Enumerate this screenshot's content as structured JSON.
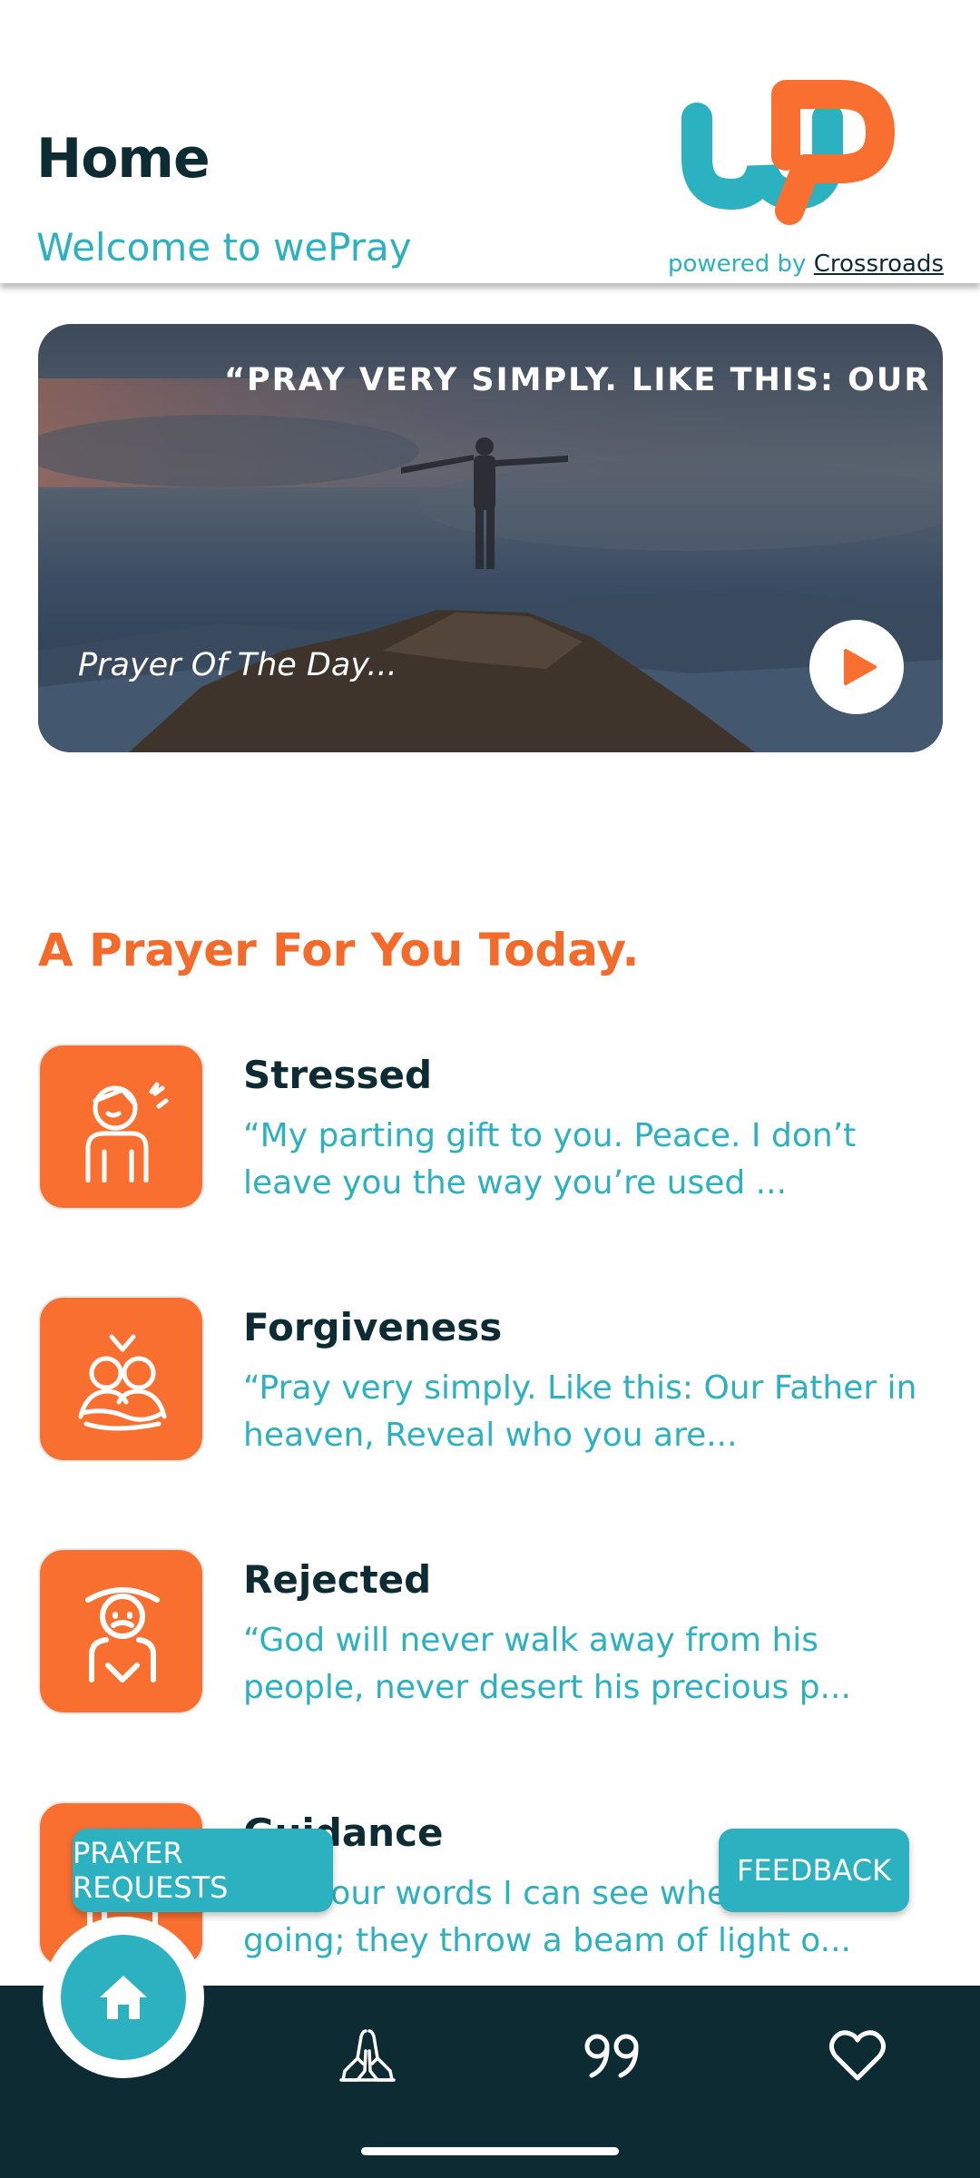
{
  "header": {
    "title": "Home",
    "subtitle": "Welcome to wePray",
    "powered_prefix": "powered by",
    "powered_link": "Crossroads"
  },
  "hero": {
    "quote": "“PRAY VERY SIMPLY. LIKE THIS: OUR FATH",
    "caption": "Prayer Of The Day..."
  },
  "section": {
    "title": "A Prayer For You Today."
  },
  "prayers": [
    {
      "name": "Stressed",
      "line1": "“My parting gift to you. Peace. I don’t",
      "line2": "leave you the way you’re used ..."
    },
    {
      "name": "Forgiveness",
      "line1": "“Pray very simply. Like this: Our Father in",
      "line2": "heaven, Reveal who you are..."
    },
    {
      "name": "Rejected",
      "line1": "“God will never walk away from his",
      "line2": "people, never desert his precious p..."
    },
    {
      "name": "Guidance",
      "line1": "“By your words I can see where I’m",
      "line2": "going; they throw a beam of light o..."
    }
  ],
  "fabs": {
    "left": "PRAYER REQUESTS",
    "right": "FEEDBACK"
  },
  "nav": {
    "items": [
      "home-icon",
      "praying-hands-icon",
      "quote-icon",
      "heart-icon"
    ]
  },
  "colors": {
    "teal": "#2bb1bf",
    "orange": "#f96f30",
    "dark": "#0c2b33"
  }
}
